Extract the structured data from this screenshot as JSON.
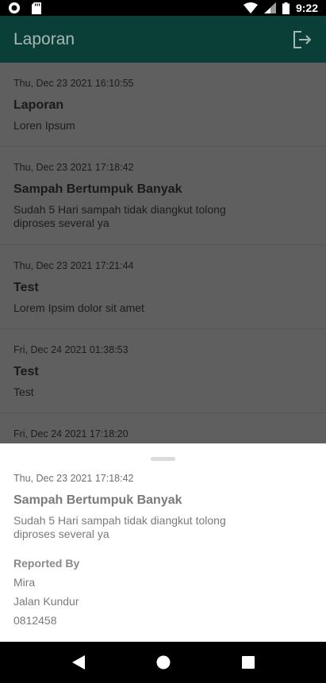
{
  "status_bar": {
    "time": "9:22",
    "icons": [
      "record-icon",
      "sd-card-icon",
      "wifi-icon",
      "signal-icon",
      "battery-icon"
    ]
  },
  "app_bar": {
    "title": "Laporan",
    "logout_icon": "logout-icon"
  },
  "reports": [
    {
      "date": "Thu, Dec 23 2021 16:10:55",
      "title": "Laporan",
      "body": "Loren Ipsum"
    },
    {
      "date": "Thu, Dec 23 2021 17:18:42",
      "title": "Sampah Bertumpuk Banyak",
      "body": "Sudah 5 Hari sampah tidak diangkut tolong diproses several ya"
    },
    {
      "date": "Thu, Dec 23 2021 17:21:44",
      "title": "Test",
      "body": "Lorem Ipsim dolor sit amet"
    },
    {
      "date": "Fri, Dec 24 2021 01:38:53",
      "title": "Test",
      "body": "Test"
    },
    {
      "date": "Fri, Dec 24 2021 17:18:20",
      "title": "",
      "body": ""
    }
  ],
  "detail_sheet": {
    "date": "Thu, Dec 23 2021 17:18:42",
    "title": "Sampah Bertumpuk Banyak",
    "body": "Sudah 5 Hari sampah tidak diangkut tolong diproses several ya",
    "reported_by_label": "Reported By",
    "reporter_name": "Mira",
    "reporter_address": "Jalan Kundur",
    "reporter_phone": "0812458"
  },
  "nav_bar": {
    "icons": [
      "back-icon",
      "home-icon",
      "recents-icon"
    ]
  }
}
